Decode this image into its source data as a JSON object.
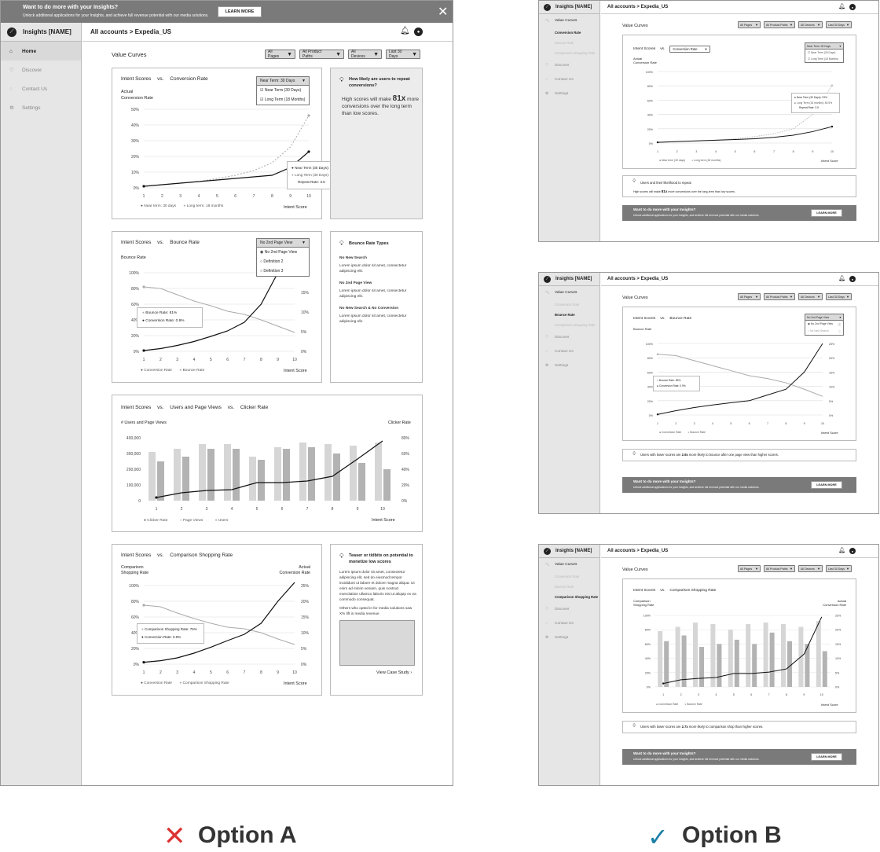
{
  "option_a": {
    "label": "Option A",
    "banner": {
      "title": "Want to do more with your Insights?",
      "subtitle": "Unlock additional applications for your Insights, and achieve full revenue potential with our media solutions.",
      "button": "LEARN MORE"
    },
    "app_name": "Insights [NAME]",
    "breadcrumb": "All accounts > Expedia_US",
    "nav": [
      "Home",
      "Discover",
      "Contact Us",
      "Settings"
    ],
    "page_title": "Value Curves",
    "filters": [
      "All Pages",
      "All Product Paths",
      "All Devices",
      "Last 30 Days"
    ],
    "card1": {
      "title": "Intent Scores",
      "vs": "vs.",
      "title2": "Conversion Rate",
      "ylabel1": "Actual",
      "ylabel2": "Conversion Rate",
      "dropdown": "Near Term: 30 Days",
      "options": [
        "Near Term (30 Days)",
        "Long Term (18 Months)"
      ],
      "tooltip": [
        "Near Term (30 Days): 23%",
        "Long Term (30 Days): 48%",
        "Repeat Rate: 3.5"
      ],
      "legend": [
        "Near term: 30 days",
        "Long term: 18 months"
      ],
      "xlabel": "Intent Score"
    },
    "card1_side": {
      "title": "How likely are users to repeat conversions?",
      "text": "High scores will make 81x more conversions over the long term than low scores."
    },
    "card2": {
      "title": "Intent Scores",
      "vs": "vs.",
      "title2": "Bounce Rate",
      "ylabel": "Bounce Rate",
      "dropdown": "No 2nd Page View",
      "options": [
        "No 2nd Page View",
        "Definition 2",
        "Definition 3"
      ],
      "tooltip": [
        "Bounce Rate: 81%",
        "Conversion Rate: 0.9%"
      ],
      "legend": [
        "Conversion Rate",
        "Bounce Rate"
      ],
      "xlabel": "Intent Score"
    },
    "card2_side": {
      "title": "Bounce Rate Types",
      "items": [
        {
          "h": "No New Search",
          "t": "Lorem ipsum dolor sit amet, consectetur adipiscing elit."
        },
        {
          "h": "No 2nd Page View",
          "t": "Lorem ipsum dolor sit amet, consectetur adipiscing elit."
        },
        {
          "h": "No New Search & No Conversion",
          "t": "Lorem ipsum dolor sit amet, consectetur adipiscing elit."
        }
      ]
    },
    "card3": {
      "title": "Intent Scores",
      "vs": "vs.",
      "title2": "Users and Page Views",
      "vs2": "vs.",
      "title3": "Clicker Rate",
      "ylabel_left": "# Users and Page Views",
      "ylabel_right": "Clicker Rate",
      "legend": [
        "Clicker Rate",
        "Page Views",
        "Users"
      ],
      "xlabel": "Intent Score"
    },
    "card4": {
      "title": "Intent Scores",
      "vs": "vs.",
      "title2": "Comparison Shopping Rate",
      "ylabel_left1": "Comparison",
      "ylabel_left2": "Shopping Rate",
      "ylabel_right1": "Actual",
      "ylabel_right2": "Conversion Rate",
      "tooltip": [
        "Comparison Shopping Rate: 75%",
        "Conversion Rate: 0.9%"
      ],
      "legend": [
        "Conversion Rate",
        "Comparison Shopping Rate"
      ],
      "xlabel": "Intent Score"
    },
    "card4_side": {
      "title": "Teaser or tidbits on potential to monetize low scores",
      "p1": "Lorem ipsum dolor sit amet, consectetur adipiscing elit, sed do eiusmod tempor incididunt ut labore et dolore magna aliqua. Ut enim ad minim veniam, quis nostrud exercitation ullamco laboris nisi ut aliquip ex ea commodo consequat.",
      "p2": "Others who opted in for media solutions saw X% lift in media revenue",
      "link": "View Case Study"
    }
  },
  "option_b": {
    "label": "Option B",
    "app_name": "Insights [NAME]",
    "breadcrumb": "All accounts > Expedia_US",
    "nav_top": "Value Curves",
    "sub_items": [
      "Conversion Rate",
      "Bounce Rate",
      "Comparison Shopping Rate"
    ],
    "nav": [
      "Discover",
      "Contact Us",
      "Settings"
    ],
    "page_title": "Value Curves",
    "filters": [
      "All Pages",
      "All Product Paths",
      "All Devices",
      "Last 30 Days"
    ],
    "banner": {
      "title": "Want to do more with your Insights?",
      "subtitle": "Unlock additional applications for your Insights, and achieve full revenue potential with our media solutions.",
      "button": "LEARN MORE"
    },
    "s1": {
      "title": "Intent Scores",
      "vs": "vs.",
      "dropdown_value": "Conversion Rate",
      "ylabel1": "Actual",
      "ylabel2": "Conversion Rate",
      "dropdown": "Near Term: 30 Days",
      "options": [
        "Near Term (30 Days)",
        "Long Term (18 Months)"
      ],
      "tooltip": [
        "Near Term (30 Days): 23%",
        "Long Term (18 months): 80.5%",
        "Repeat Rate: 3.5"
      ],
      "legend": [
        "Near term (30 days)",
        "Long term (18 months)"
      ],
      "xlabel": "Intent Score",
      "insight_title": "Users and their likelihood to repeat",
      "insight_text_pre": "High scores will make ",
      "insight_strong": "81x",
      "insight_text_post": " more conversions over the long-term than low scores."
    },
    "s2": {
      "title": "Intent Scores",
      "vs": "vs.",
      "title2": "Bounce Rate",
      "ylabel": "Bounce Rate",
      "dropdown": "No 2nd Page View",
      "options": [
        "No 2nd Page View",
        "No New Search"
      ],
      "tooltip": [
        "Bounce Rate: 85%",
        "Conversion Rate: 0.9%"
      ],
      "legend": [
        "Conversion Rate",
        "Bounce Rate"
      ],
      "xlabel": "Intent Score",
      "insight_pre": "Users with lower scores are ",
      "insight_strong": "2.9x",
      "insight_post": " more likely to bounce after one page view than higher scores."
    },
    "s3": {
      "title": "Intent Scores",
      "vs": "vs.",
      "title2": "Comparison Shopping Rate",
      "ylabel_left1": "Comparison",
      "ylabel_left2": "Shopping Rate",
      "ylabel_right1": "Actual",
      "ylabel_right2": "Conversion Rate",
      "legend": [
        "Conversion Rate",
        "Bounce Rate"
      ],
      "xlabel": "Intent Score",
      "insight_pre": "Users with lower scores are ",
      "insight_strong": "2.7x",
      "insight_post": " more likely to comparison shop than higher scores."
    }
  },
  "chart_data": [
    {
      "type": "line",
      "x": [
        1,
        2,
        3,
        4,
        5,
        6,
        7,
        8,
        9,
        10
      ],
      "y_ticks": [
        "0%",
        "10%",
        "20%",
        "30%",
        "40%",
        "50%"
      ],
      "ylim": [
        0,
        50
      ],
      "series": [
        {
          "name": "Near term: 30 days",
          "values": [
            1,
            2,
            3,
            4,
            5,
            6,
            7,
            8,
            13,
            23
          ]
        },
        {
          "name": "Long term: 18 months",
          "values": [
            1,
            2,
            3,
            4,
            6,
            8,
            11,
            16,
            26,
            46
          ]
        }
      ]
    },
    {
      "type": "line",
      "x": [
        1,
        2,
        3,
        4,
        5,
        6,
        7,
        8,
        9,
        10
      ],
      "y_ticks": [
        "0%",
        "20%",
        "40%",
        "60%",
        "80%",
        "100%"
      ],
      "y2_ticks": [
        "0%",
        "5%",
        "10%",
        "15%",
        "20%"
      ],
      "series": [
        {
          "name": "Conversion Rate",
          "values": [
            0.2,
            0.7,
            1.5,
            2.5,
            3.8,
            5.2,
            7.4,
            12,
            20,
            28
          ]
        },
        {
          "name": "Bounce Rate",
          "values": [
            82,
            80,
            72,
            64,
            58,
            51,
            47,
            40,
            32,
            24
          ]
        }
      ]
    },
    {
      "type": "bar",
      "x": [
        1,
        2,
        3,
        4,
        5,
        6,
        7,
        8,
        9,
        10
      ],
      "y_ticks": [
        "0",
        "100,000",
        "200,000",
        "300,000",
        "400,000"
      ],
      "y2_ticks": [
        "0%",
        "20%",
        "40%",
        "60%",
        "80%"
      ],
      "series": [
        {
          "name": "Page Views",
          "values": [
            310000,
            330000,
            360000,
            360000,
            280000,
            340000,
            370000,
            360000,
            350000,
            370000
          ]
        },
        {
          "name": "Users",
          "values": [
            250000,
            280000,
            330000,
            330000,
            260000,
            330000,
            340000,
            300000,
            240000,
            200000
          ]
        },
        {
          "name": "Clicker Rate",
          "values": [
            4,
            10,
            13,
            14,
            23,
            23,
            25,
            31,
            53,
            76
          ]
        }
      ]
    },
    {
      "type": "line",
      "x": [
        1,
        2,
        3,
        4,
        5,
        6,
        7,
        8,
        9,
        10
      ],
      "y_ticks": [
        "0%",
        "20%",
        "40%",
        "60%",
        "80%",
        "100%"
      ],
      "y2_ticks": [
        "0%",
        "5%",
        "10%",
        "15%",
        "20%",
        "25%"
      ],
      "series": [
        {
          "name": "Conversion Rate",
          "values": [
            0.6,
            1.1,
            2.0,
            3.5,
            5.4,
            7.5,
            9.5,
            13,
            20,
            26
          ]
        },
        {
          "name": "Comparison Shopping Rate",
          "values": [
            75,
            73,
            65,
            58,
            52,
            47,
            45,
            40,
            32,
            25
          ]
        }
      ]
    }
  ]
}
